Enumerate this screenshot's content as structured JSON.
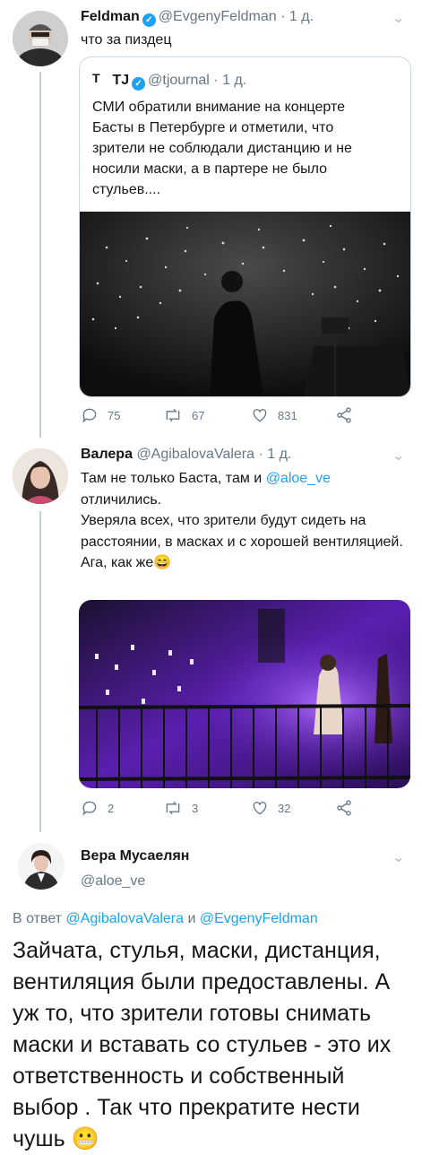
{
  "tweet1": {
    "name": "Feldman",
    "handle": "@EvgenyFeldman",
    "time": "· 1 д.",
    "text": "что за пиздец",
    "quote": {
      "name": "TJ",
      "handle": "@tjournal",
      "time": "· 1 д.",
      "text": "СМИ обратили внимание на концерте Басты в Петербурге и отметили, что зрители не соблюдали дистанцию и не носили маски, а в партере не было стульев...."
    },
    "replies": "75",
    "retweets": "67",
    "likes": "831"
  },
  "tweet2": {
    "name": "Валера",
    "handle": "@AgibalovaValera",
    "time": "· 1 д.",
    "text_line1": "Там не только Баста, там и ",
    "mention": "@aloe_ve",
    "text_line2": "отличились.",
    "text_rest": "Уверяла всех, что зрители будут сидеть на расстоянии, в масках и с хорошей вентиляцией.",
    "text_end": "Ага, как же",
    "emoji": "😄",
    "replies": "2",
    "retweets": "3",
    "likes": "32"
  },
  "tweet3": {
    "name": "Вера Мусаелян",
    "handle": "@aloe_ve",
    "reply_prefix": "В ответ ",
    "reply_user1": "@AgibalovaValera",
    "reply_and": " и ",
    "reply_user2": "@EvgenyFeldman",
    "text": "Зайчата, стулья, маски, дистанция, вентиляция были предоставлены. А уж то, что зрители готовы снимать маски и вставать со стульев - это их ответственность и собственный выбор . Так что прекратите нести чушь",
    "emoji": "😬"
  },
  "icons": [
    "reply-icon",
    "retweet-icon",
    "like-icon",
    "share-icon",
    "verified-icon",
    "chevron-down-icon"
  ],
  "colors": {
    "link": "#1da1f2",
    "verified": "#1da1f2",
    "secondary": "#657786",
    "concert_purple": "#7a2bd6"
  }
}
